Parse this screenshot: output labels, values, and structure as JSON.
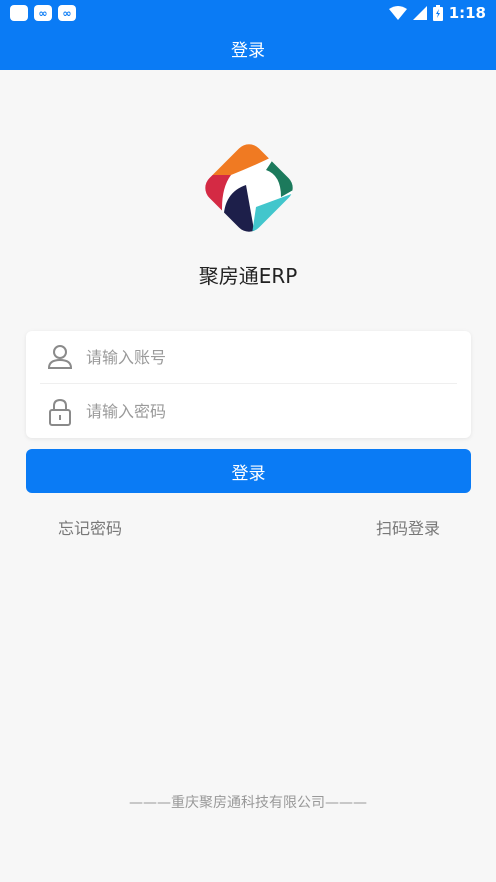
{
  "status_bar": {
    "time": "1:18",
    "icons": [
      "square-icon",
      "app-icon-1",
      "app-icon-2",
      "wifi-icon",
      "signal-icon",
      "battery-icon"
    ]
  },
  "header": {
    "title": "登录"
  },
  "app": {
    "name": "聚房通ERP"
  },
  "form": {
    "account_placeholder": "请输入账号",
    "password_placeholder": "请输入密码",
    "login_label": "登录"
  },
  "links": {
    "forgot": "忘记密码",
    "scan": "扫码登录"
  },
  "footer": {
    "text": "———重庆聚房通科技有限公司———"
  },
  "colors": {
    "primary": "#0a7bf5",
    "background": "#f7f7f7"
  }
}
